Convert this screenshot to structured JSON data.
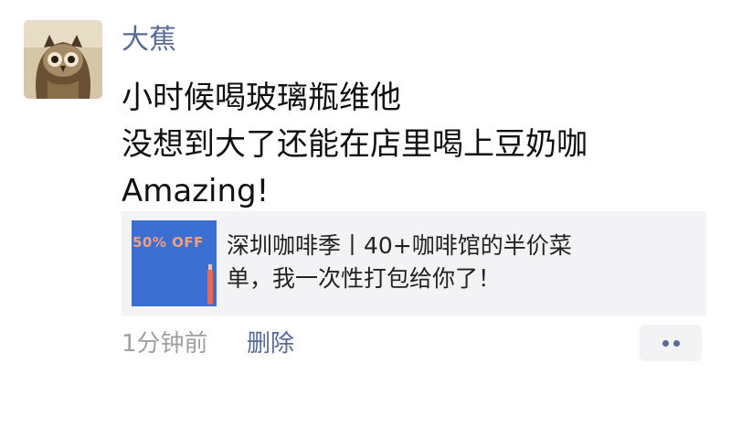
{
  "post": {
    "avatar_icon": "owl-avatar",
    "username": "大蕉",
    "text_lines": [
      "小时候喝玻璃瓶维他",
      "没想到大了还能在店里喝上豆奶咖",
      "Amazing!"
    ],
    "link_card": {
      "thumbnail_badge": "50% OFF",
      "title_lines": [
        "深圳咖啡季丨40+咖啡馆的半价菜",
        "单，我一次性打包给你了！"
      ]
    },
    "timestamp": "1分钟前",
    "delete_label": "删除",
    "more_icon": "more-dots-icon"
  },
  "colors": {
    "username": "#576b95",
    "link": "#576b95",
    "card_background": "#f3f3f5",
    "thumbnail_blue": "#3b6fd1",
    "badge_text": "#f1a07f",
    "timestamp": "#a0a0a0"
  }
}
